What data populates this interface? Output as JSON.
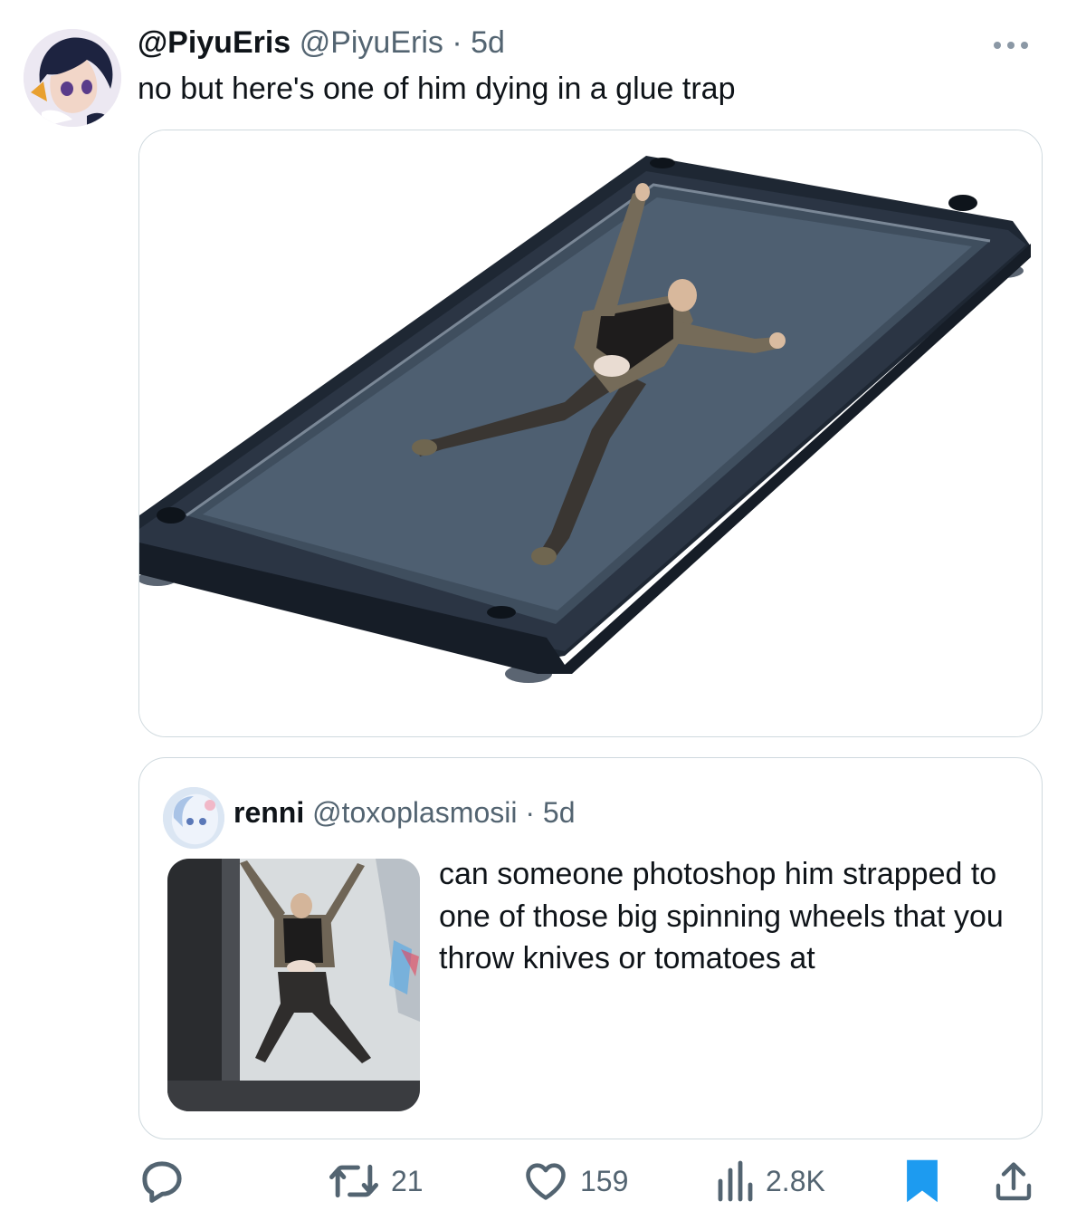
{
  "tweet": {
    "display_name": "@PiyuEris",
    "handle": "@PiyuEris",
    "separator": "·",
    "time": "5d",
    "text": "no but here's one of him dying in a glue trap"
  },
  "quoted_tweet": {
    "display_name": "renni",
    "handle": "@toxoplasmosii",
    "separator": "·",
    "time": "5d",
    "text": "can someone photoshop him strapped to one of those big spinning wheels that you throw knives or tomatoes at"
  },
  "actions": {
    "retweets": "21",
    "likes": "159",
    "views": "2.8K"
  },
  "colors": {
    "text": "#0f1419",
    "secondary": "#536471",
    "accent": "#1d9bf0",
    "border": "#cfd9de"
  },
  "icons": [
    "more-icon",
    "reply-icon",
    "retweet-icon",
    "like-icon",
    "views-icon",
    "bookmark-icon",
    "share-icon"
  ]
}
